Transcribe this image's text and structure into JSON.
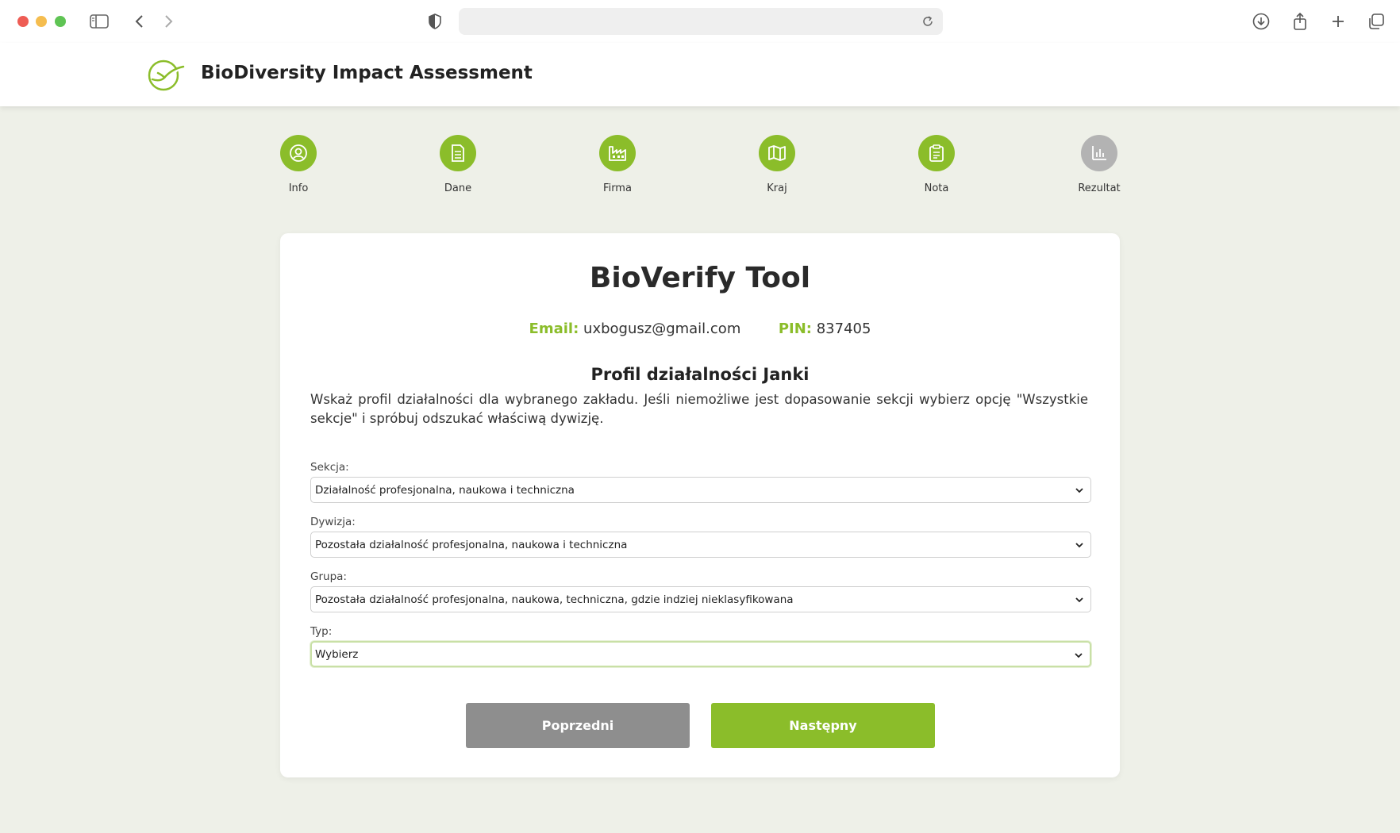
{
  "app": {
    "title": "BioDiversity Impact Assessment"
  },
  "colors": {
    "accent": "#8bbd2a",
    "inactive_step": "#b3b3b3",
    "prev_button": "#8e8e8e",
    "background": "#eef0e8"
  },
  "steps": [
    {
      "label": "Info",
      "icon": "user-icon",
      "state": "done"
    },
    {
      "label": "Dane",
      "icon": "document-icon",
      "state": "done"
    },
    {
      "label": "Firma",
      "icon": "factory-icon",
      "state": "done"
    },
    {
      "label": "Kraj",
      "icon": "map-icon",
      "state": "done"
    },
    {
      "label": "Nota",
      "icon": "clipboard-icon",
      "state": "done"
    },
    {
      "label": "Rezultat",
      "icon": "bar-chart-icon",
      "state": "pending"
    }
  ],
  "card": {
    "title": "BioVerify Tool",
    "email_label": "Email:",
    "email_value": "uxbogusz@gmail.com",
    "pin_label": "PIN:",
    "pin_value": "837405",
    "profile_title": "Profil działalności Janki",
    "description": "Wskaż profil działalności dla wybranego zakładu. Jeśli niemożliwe jest dopasowanie sekcji wybierz opcję \"Wszystkie sekcje\" i spróbuj odszukać właściwą dywizję."
  },
  "fields": {
    "sekcja": {
      "label": "Sekcja:",
      "value": "Działalność profesjonalna, naukowa i techniczna"
    },
    "dywizja": {
      "label": "Dywizja:",
      "value": "Pozostała działalność profesjonalna, naukowa i techniczna"
    },
    "grupa": {
      "label": "Grupa:",
      "value": "Pozostała działalność profesjonalna, naukowa, techniczna, gdzie indziej nieklasyfikowana"
    },
    "typ": {
      "label": "Typ:",
      "value": "Wybierz"
    }
  },
  "buttons": {
    "prev": "Poprzedni",
    "next": "Następny"
  }
}
